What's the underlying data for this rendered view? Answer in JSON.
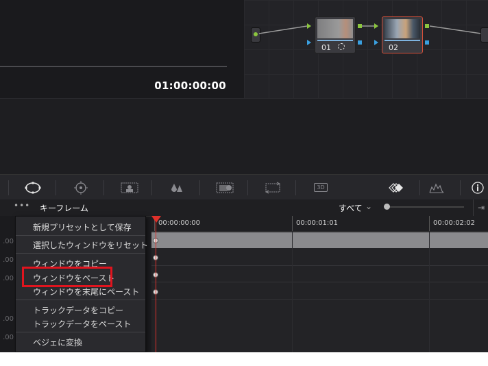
{
  "viewer": {
    "timecode": "01:00:00:00"
  },
  "nodes": [
    {
      "label": "01"
    },
    {
      "label": "02"
    }
  ],
  "toolbar": {
    "icons": [
      "window-circle-icon",
      "tracker-icon",
      "magic-mask-icon",
      "blur-icon",
      "key-icon",
      "sizing-icon",
      "3d-icon",
      "keyframes-icon",
      "scopes-icon",
      "info-icon"
    ],
    "three_d_label": "3D"
  },
  "keyframes": {
    "more": "•••",
    "title": "キーフレーム",
    "filter": "すべて",
    "ruler": [
      "00:00:00:00",
      "00:00:01:01",
      "00:00:02:02"
    ],
    "left_values": [
      ".00",
      ".00",
      ".00",
      ".00",
      ".00",
      ".00"
    ]
  },
  "context_menu": {
    "items": [
      "新規プリセットとして保存",
      "選択したウィンドウをリセット",
      "ウィンドウをコピー",
      "ウィンドウをペースト",
      "ウィンドウを末尾にペースト",
      "トラックデータをコピー",
      "トラックデータをペースト",
      "ベジェに変換"
    ],
    "highlighted_item": "ウィンドウをペースト"
  },
  "colors": {
    "highlight": "#e0141e",
    "playhead": "#e0302a",
    "selected_node": "#d8503a"
  }
}
